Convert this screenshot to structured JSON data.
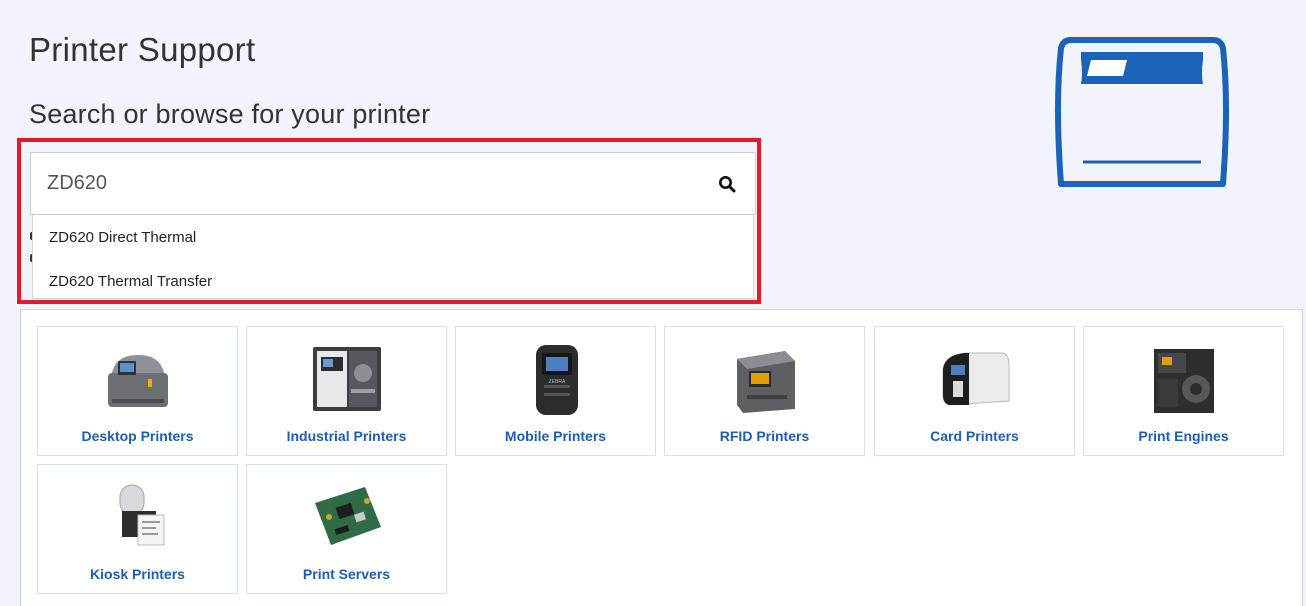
{
  "header": {
    "title": "Printer Support",
    "subtitle": "Search or browse for your printer"
  },
  "search": {
    "value": "ZD620",
    "placeholder": "",
    "icon": "search-icon"
  },
  "suggestions": [
    "ZD620 Direct Thermal",
    "ZD620 Thermal Transfer"
  ],
  "categories": [
    {
      "label": "Desktop Printers",
      "icon": "desktop-printer-icon"
    },
    {
      "label": "Industrial Printers",
      "icon": "industrial-printer-icon"
    },
    {
      "label": "Mobile Printers",
      "icon": "mobile-printer-icon"
    },
    {
      "label": "RFID Printers",
      "icon": "rfid-printer-icon"
    },
    {
      "label": "Card Printers",
      "icon": "card-printer-icon"
    },
    {
      "label": "Print Engines",
      "icon": "print-engine-icon"
    },
    {
      "label": "Kiosk Printers",
      "icon": "kiosk-printer-icon"
    },
    {
      "label": "Print Servers",
      "icon": "print-server-icon"
    }
  ],
  "colors": {
    "accent_blue": "#1a5fb4",
    "highlight_red": "#e21b2b",
    "background": "#f2f4fb"
  }
}
